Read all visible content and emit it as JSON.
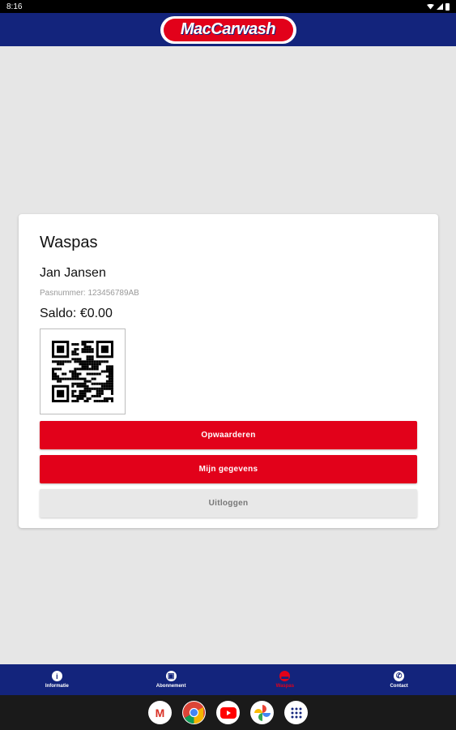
{
  "status_bar": {
    "time": "8:16"
  },
  "header": {
    "logo_text": "MacCarwash"
  },
  "card": {
    "title": "Waspas",
    "name": "Jan Jansen",
    "pasnummer": "Pasnummer: 123456789AB",
    "saldo": "Saldo: €0.00",
    "buttons": {
      "opwaarderen": "Opwaarderen",
      "gegevens": "Mijn gegevens",
      "uitloggen": "Uitloggen"
    }
  },
  "bottom_nav": [
    {
      "label": "Informatie",
      "icon": "info-icon",
      "active": false
    },
    {
      "label": "Abonnement",
      "icon": "subscription-icon",
      "active": false
    },
    {
      "label": "Waspas",
      "icon": "card-icon",
      "active": true
    },
    {
      "label": "Contact",
      "icon": "phone-icon",
      "active": false
    }
  ],
  "dock": [
    "gmail-icon",
    "chrome-icon",
    "youtube-icon",
    "photos-icon",
    "app-drawer-icon"
  ],
  "colors": {
    "brand_blue": "#13247c",
    "brand_red": "#e2011a",
    "background": "#e6e6e6"
  }
}
